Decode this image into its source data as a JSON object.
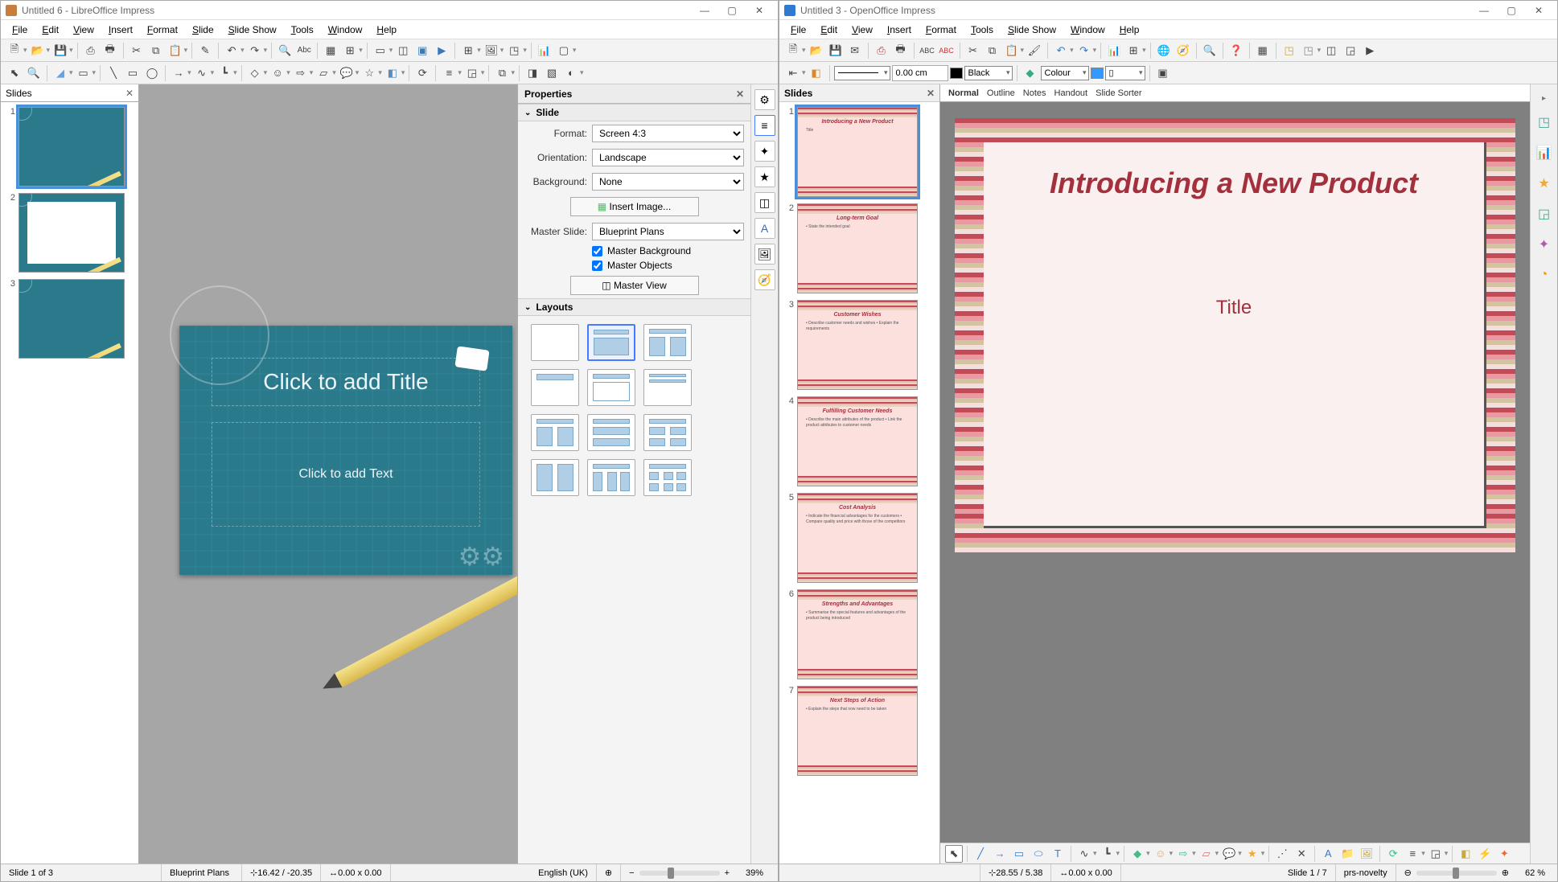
{
  "left": {
    "title": "Untitled 6 - LibreOffice Impress",
    "menu": [
      "File",
      "Edit",
      "View",
      "Insert",
      "Format",
      "Slide",
      "Slide Show",
      "Tools",
      "Window",
      "Help"
    ],
    "panels": {
      "slides": "Slides",
      "properties": "Properties"
    },
    "sections": {
      "slide": "Slide",
      "layouts": "Layouts"
    },
    "form": {
      "format_label": "Format:",
      "format_value": "Screen 4:3",
      "orientation_label": "Orientation:",
      "orientation_value": "Landscape",
      "background_label": "Background:",
      "background_value": "None",
      "insert_image": "Insert Image...",
      "master_slide_label": "Master Slide:",
      "master_slide_value": "Blueprint Plans",
      "cb_master_bg": "Master Background",
      "cb_master_obj": "Master Objects",
      "master_view": "Master View"
    },
    "slide_canvas": {
      "title_ph": "Click to add Title",
      "text_ph": "Click to add Text"
    },
    "thumbs": [
      1,
      2,
      3
    ],
    "status": {
      "slide": "Slide 1 of 3",
      "template": "Blueprint Plans",
      "coords": "16.42 / -20.35",
      "size": "0.00 x 0.00",
      "lang": "English (UK)",
      "zoom": "39%"
    }
  },
  "right": {
    "title": "Untitled 3 - OpenOffice Impress",
    "menu": [
      "File",
      "Edit",
      "View",
      "Insert",
      "Format",
      "Tools",
      "Slide Show",
      "Window",
      "Help"
    ],
    "toolbar2": {
      "spin": "0.00 cm",
      "black": "Black",
      "colour": "Colour",
      "blue_swatch": "#3399ff"
    },
    "panels": {
      "slides": "Slides"
    },
    "viewtabs": [
      "Normal",
      "Outline",
      "Notes",
      "Handout",
      "Slide Sorter"
    ],
    "thumbs": [
      {
        "n": 1,
        "head": "Introducing a New Product",
        "body": "Title"
      },
      {
        "n": 2,
        "head": "Long-term Goal",
        "body": "• State the intended goal"
      },
      {
        "n": 3,
        "head": "Customer Wishes",
        "body": "• Describe customer needs and wishes\\n• Explain the requirements"
      },
      {
        "n": 4,
        "head": "Fulfilling Customer Needs",
        "body": "• Describe the main attributes of the product\\n• Link the product attributes to customer needs"
      },
      {
        "n": 5,
        "head": "Cost Analysis",
        "body": "• Indicate the financial advantages for the customers\\n• Compare quality and price with those of the competitors"
      },
      {
        "n": 6,
        "head": "Strengths and Advantages",
        "body": "• Summarise the special features and advantages of the product being introduced"
      },
      {
        "n": 7,
        "head": "Next Steps of Action",
        "body": "• Explain the steps that now need to be taken"
      }
    ],
    "canvas": {
      "title": "Introducing a New Product",
      "sub": "Title"
    },
    "status": {
      "coords": "28.55 / 5.38",
      "size": "0.00 x 0.00",
      "slide": "Slide 1 / 7",
      "template": "prs-novelty",
      "zoom": "62 %"
    }
  }
}
